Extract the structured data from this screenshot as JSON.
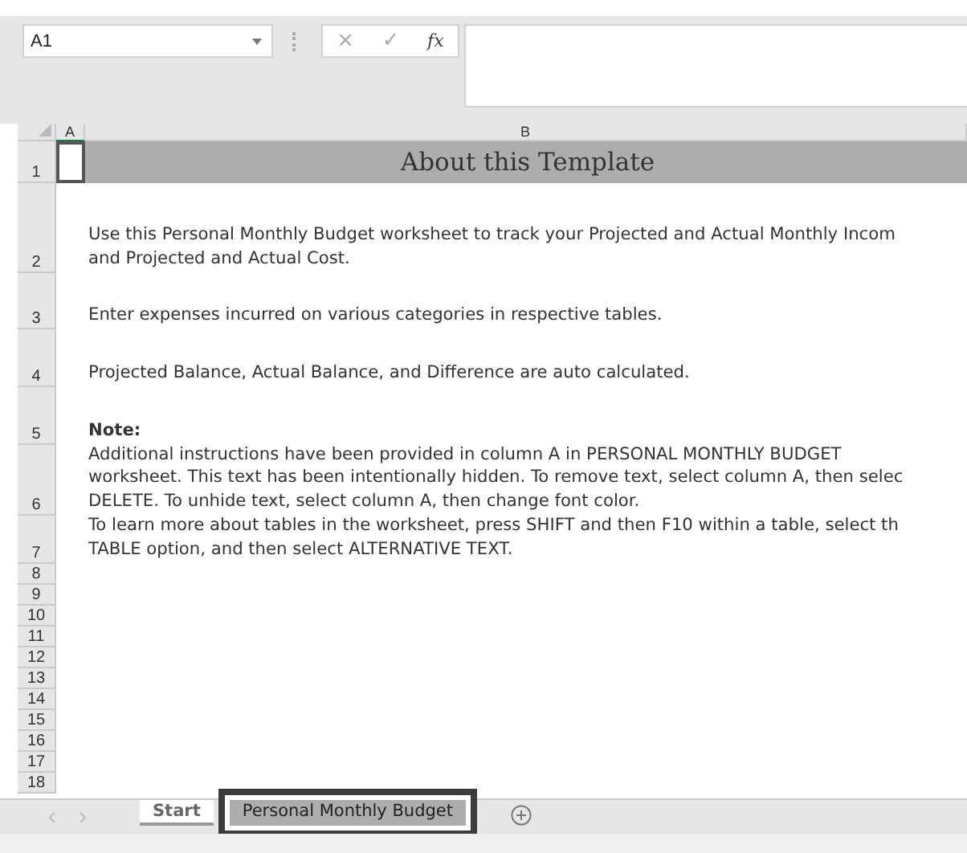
{
  "name_box": {
    "value": "A1"
  },
  "formula_bar": {
    "cancel": "×",
    "enter": "✓",
    "function": "fx"
  },
  "columns": [
    "A",
    "B"
  ],
  "rows": [
    {
      "number": "1",
      "kind": "title",
      "lines": [
        "About this Template"
      ]
    },
    {
      "number": "2",
      "kind": "text",
      "lines": [
        "Use this Personal Monthly Budget worksheet to track your Projected and Actual Monthly Incom",
        "and Projected and Actual Cost."
      ]
    },
    {
      "number": "3",
      "kind": "text",
      "lines": [
        "Enter expenses incurred on various categories in respective tables."
      ]
    },
    {
      "number": "4",
      "kind": "text",
      "lines": [
        "Projected Balance, Actual Balance, and Difference are auto calculated."
      ]
    },
    {
      "number": "5",
      "kind": "heading",
      "lines": [
        "Note:"
      ]
    },
    {
      "number": "6",
      "kind": "text",
      "lines": [
        "Additional instructions have been provided in column A in PERSONAL MONTHLY BUDGET",
        "worksheet. This text has been intentionally hidden. To remove text, select column A, then selec",
        "DELETE. To unhide text, select column A, then change font color."
      ]
    },
    {
      "number": "7",
      "kind": "text",
      "lines": [
        "To learn more about tables in the worksheet, press SHIFT and then F10 within a table, select th",
        "TABLE option, and then select ALTERNATIVE TEXT."
      ]
    },
    {
      "number": "8",
      "kind": "empty",
      "lines": []
    },
    {
      "number": "9",
      "kind": "empty",
      "lines": []
    },
    {
      "number": "10",
      "kind": "empty",
      "lines": []
    },
    {
      "number": "11",
      "kind": "empty",
      "lines": []
    },
    {
      "number": "12",
      "kind": "empty",
      "lines": []
    },
    {
      "number": "13",
      "kind": "empty",
      "lines": []
    },
    {
      "number": "14",
      "kind": "empty",
      "lines": []
    },
    {
      "number": "15",
      "kind": "empty",
      "lines": []
    },
    {
      "number": "16",
      "kind": "empty",
      "lines": []
    },
    {
      "number": "17",
      "kind": "empty",
      "lines": []
    },
    {
      "number": "18",
      "kind": "empty",
      "lines": []
    }
  ],
  "sheet_tabs": [
    {
      "label": "Start",
      "selected": false
    },
    {
      "label": "Personal Monthly Budget",
      "selected": true
    }
  ]
}
